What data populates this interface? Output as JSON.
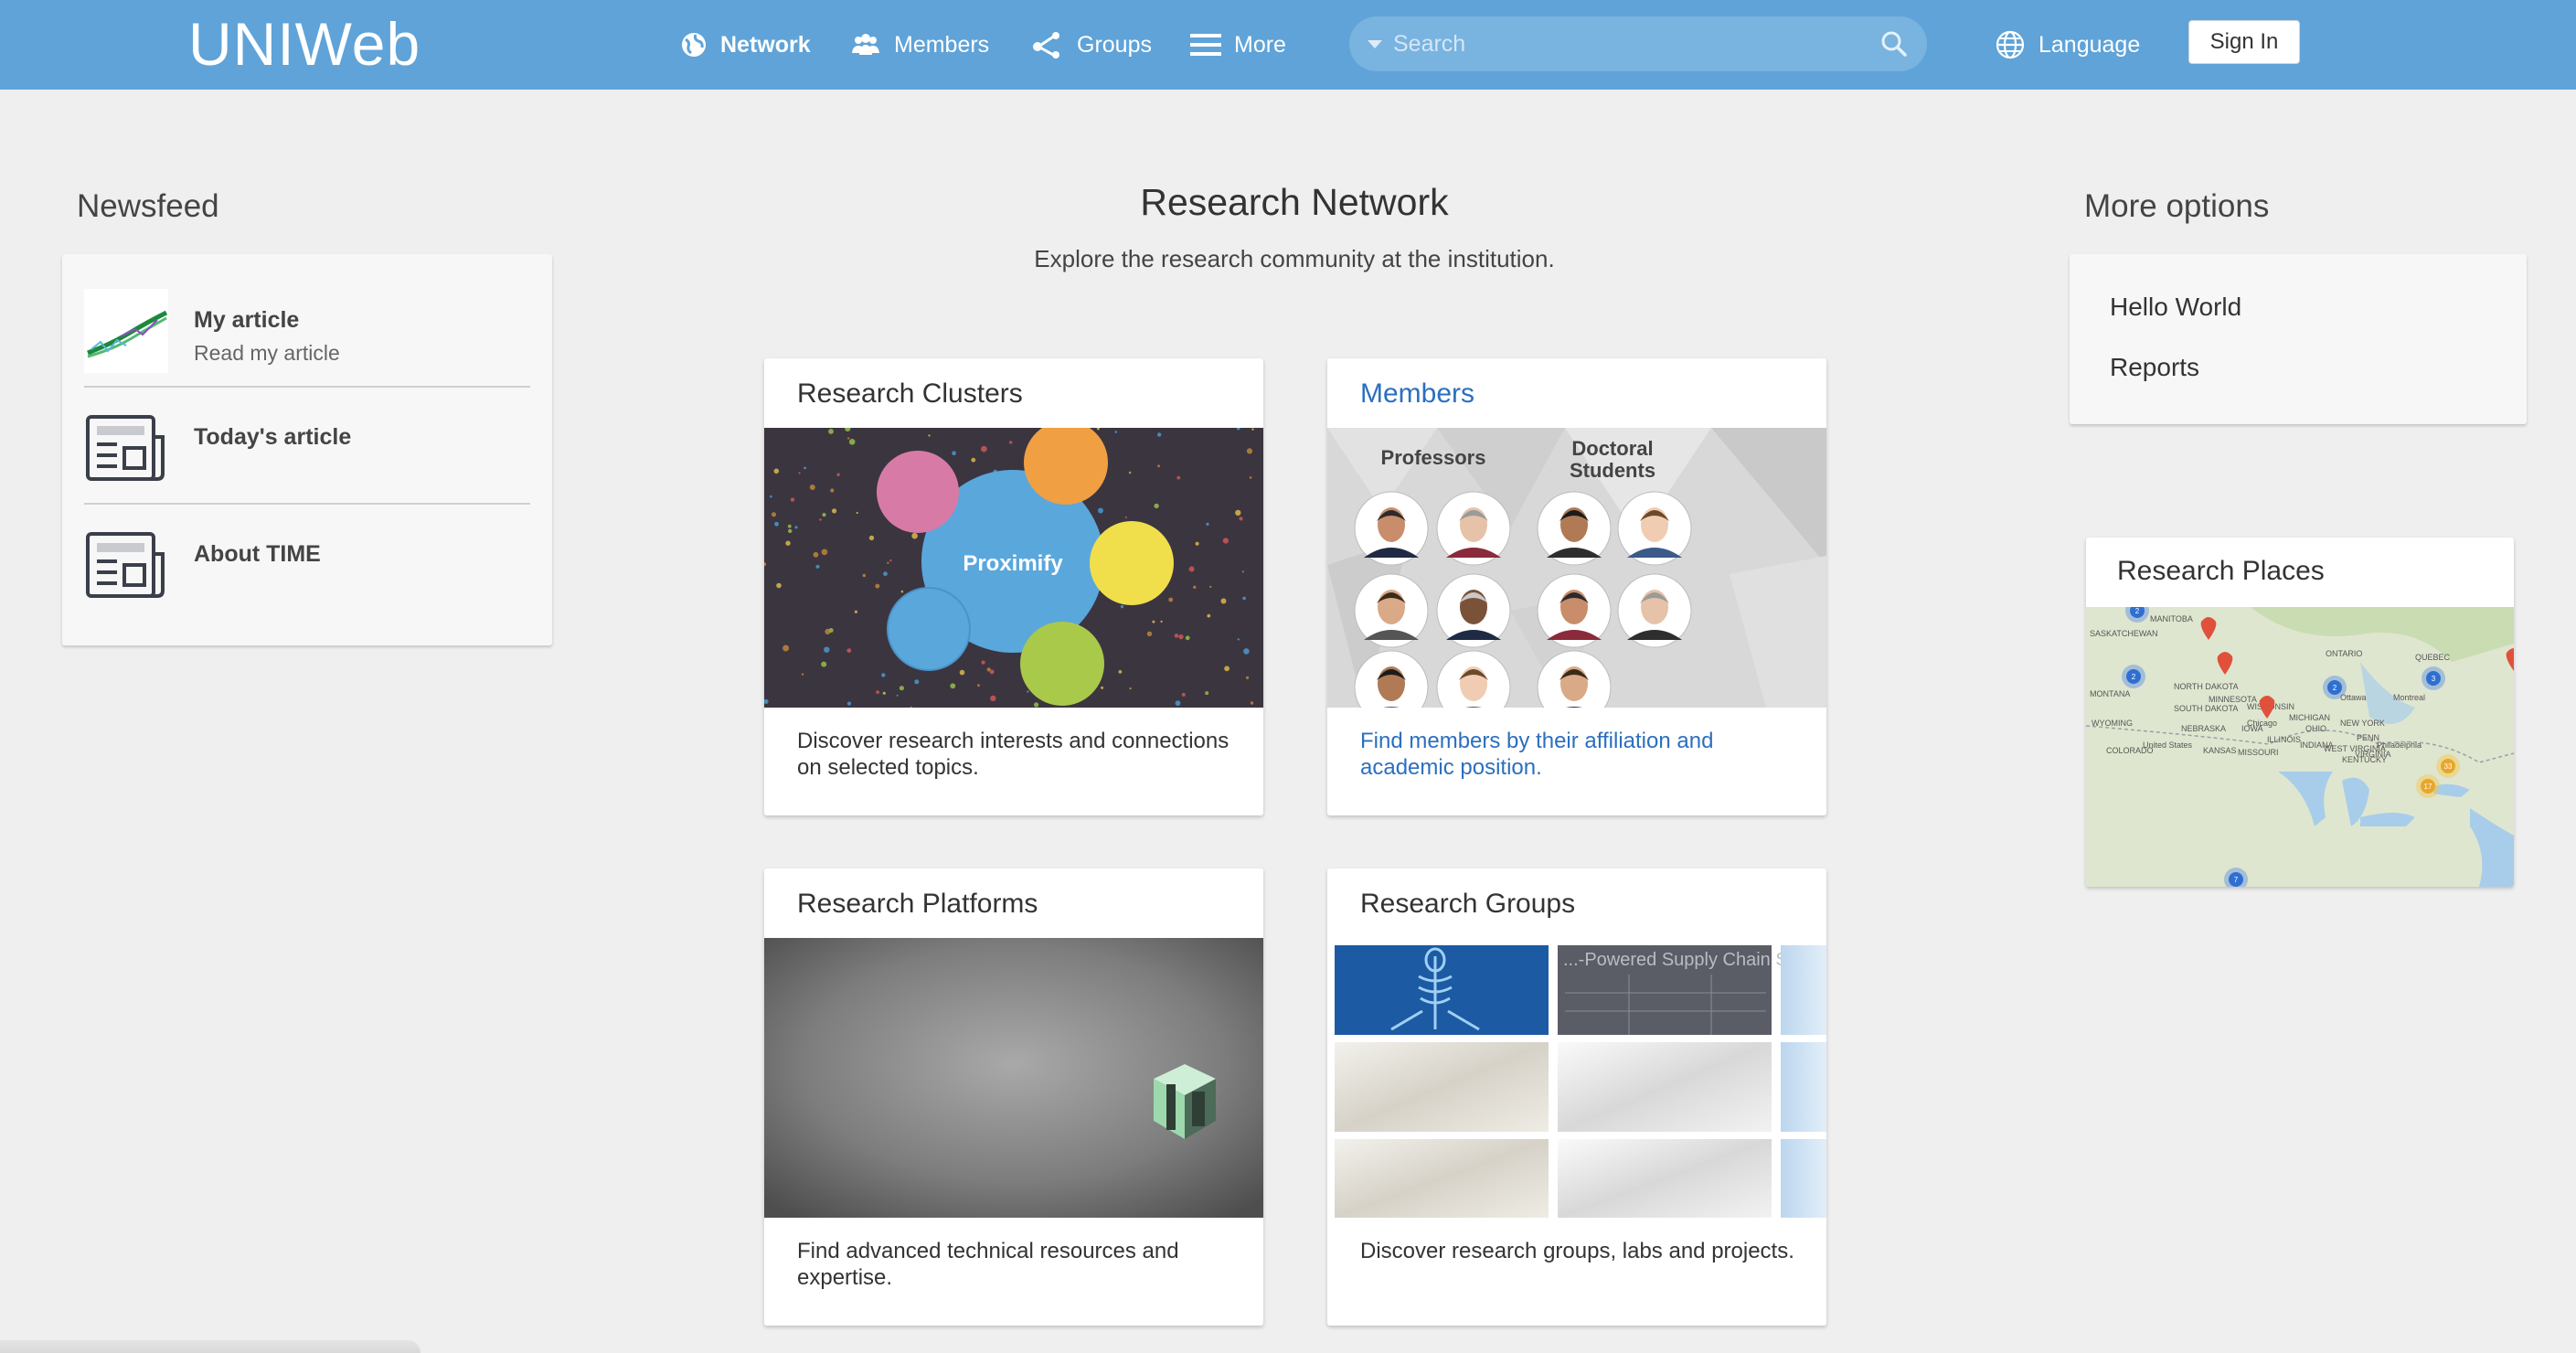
{
  "header": {
    "logo": "UNIWeb",
    "nav": [
      {
        "label": "Network",
        "icon": "globe-icon",
        "active": true
      },
      {
        "label": "Members",
        "icon": "people-icon"
      },
      {
        "label": "Groups",
        "icon": "share-nodes-icon"
      },
      {
        "label": "More",
        "icon": "menu-icon"
      }
    ],
    "search": {
      "placeholder": "Search",
      "icon": "search-icon"
    },
    "language": {
      "label": "Language",
      "icon": "globe-outline-icon"
    },
    "sign_in": "Sign In",
    "colors": {
      "bar": "#5fa3d8",
      "search_bg": "#79b3e0"
    }
  },
  "newsfeed": {
    "heading": "Newsfeed",
    "items": [
      {
        "title": "My article",
        "subtitle": "Read my article",
        "icon": "article-chart-thumbnail"
      },
      {
        "title": "Today's article",
        "subtitle": "",
        "icon": "newspaper-icon"
      },
      {
        "title": "About TIME",
        "subtitle": "",
        "icon": "newspaper-icon"
      }
    ]
  },
  "main": {
    "title": "Research Network",
    "subtitle": "Explore the research community at the institution.",
    "cards": [
      {
        "title": "Research Clusters",
        "description": "Discover research interests and connections on selected topics.",
        "image_label": "Proximify",
        "link_style": false
      },
      {
        "title": "Members",
        "description": "Find members by their affiliation and academic position.",
        "image_labels": [
          "Professors",
          "Doctoral",
          "Students"
        ],
        "link_style": true
      },
      {
        "title": "Research Platforms",
        "description": "Find advanced technical resources and expertise.",
        "link_style": false
      },
      {
        "title": "Research Groups",
        "description": "Discover research groups, labs and projects.",
        "image_label": "...-Powered Supply Chain Supercluster",
        "link_style": false
      }
    ]
  },
  "more_options": {
    "heading": "More options",
    "links": [
      "Hello World",
      "Reports"
    ]
  },
  "research_places": {
    "title": "Research Places",
    "map_labels": [
      "MANITOBA",
      "SASKATCHEWAN",
      "MONTANA",
      "NORTH DAKOTA",
      "SOUTH DAKOTA",
      "WYOMING",
      "NEBRASKA",
      "MINNESOTA",
      "IOWA",
      "WISCONSIN",
      "MICHIGAN",
      "ILLINOIS",
      "INDIANA",
      "OHIO",
      "PENN",
      "NEW YORK",
      "ONTARIO",
      "QUEBEC",
      "Ottawa",
      "Montreal",
      "Chicago",
      "Philadelphia",
      "United States",
      "KANSAS",
      "MISSOURI",
      "COLORADO",
      "KENTUCKY",
      "VIRGINIA",
      "WEST VIRGINIA"
    ],
    "cluster_counts": [
      "2",
      "2",
      "2",
      "3",
      "33",
      "17",
      "7"
    ]
  }
}
